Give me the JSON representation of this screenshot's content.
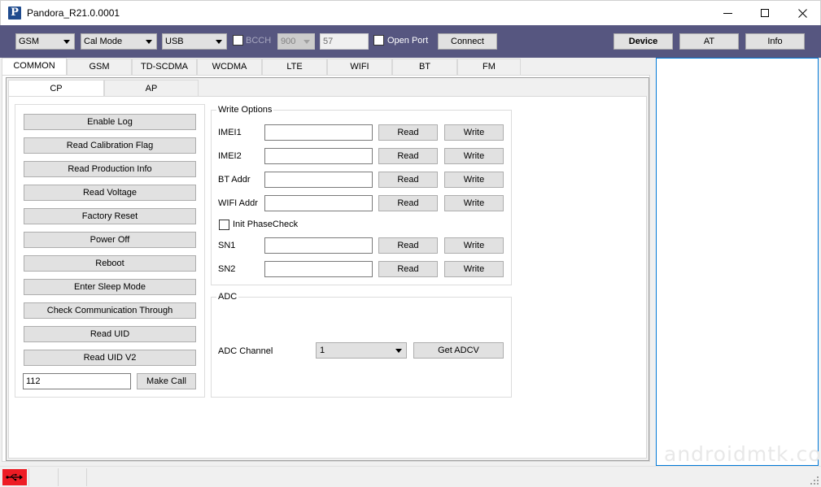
{
  "window": {
    "title": "Pandora_R21.0.0001",
    "app_icon_letter": "P",
    "controls": {
      "minimize": "minimize",
      "maximize": "maximize",
      "close": "close"
    }
  },
  "toolbar": {
    "band_select": "GSM",
    "mode_select": "Cal Mode",
    "port_select": "USB",
    "bcch_label": "BCCH",
    "bcch_checked": false,
    "freq_select": "900",
    "channel_value": "57",
    "open_port_label": "Open Port",
    "open_port_checked": false,
    "connect_label": "Connect",
    "device_label": "Device",
    "at_label": "AT",
    "info_label": "Info",
    "bg_color": "#565680"
  },
  "main_tabs": [
    {
      "label": "COMMON",
      "active": true
    },
    {
      "label": "GSM",
      "active": false
    },
    {
      "label": "TD-SCDMA",
      "active": false
    },
    {
      "label": "WCDMA",
      "active": false
    },
    {
      "label": "LTE",
      "active": false
    },
    {
      "label": "WIFI",
      "active": false
    },
    {
      "label": "BT",
      "active": false
    },
    {
      "label": "FM",
      "active": false
    }
  ],
  "sub_tabs": [
    {
      "label": "CP",
      "active": true
    },
    {
      "label": "AP",
      "active": false
    }
  ],
  "actions": {
    "buttons": [
      "Enable Log",
      "Read Calibration Flag",
      "Read Production Info",
      "Read Voltage",
      "Factory Reset",
      "Power Off",
      "Reboot",
      "Enter Sleep Mode",
      "Check Communication Through",
      "Read UID",
      "Read UID V2"
    ],
    "call_number": "112",
    "make_call_label": "Make Call"
  },
  "write_options": {
    "title": "Write Options",
    "read_label": "Read",
    "write_label": "Write",
    "fields": [
      {
        "label": "IMEI1",
        "value": ""
      },
      {
        "label": "IMEI2",
        "value": ""
      },
      {
        "label": "BT Addr",
        "value": ""
      },
      {
        "label": "WIFI Addr",
        "value": ""
      }
    ],
    "init_phasecheck_label": "Init PhaseCheck",
    "init_phasecheck_checked": false,
    "sn_fields": [
      {
        "label": "SN1",
        "value": ""
      },
      {
        "label": "SN2",
        "value": ""
      }
    ]
  },
  "adc": {
    "title": "ADC",
    "channel_label": "ADC Channel",
    "channel_value": "1",
    "get_label": "Get ADCV"
  },
  "log_panel": {
    "watermark": "androidmtk.com",
    "border_color": "#0078d7"
  },
  "statusbar": {
    "usb_icon": "usb-icon",
    "usb_status_color": "#ed1c24"
  }
}
